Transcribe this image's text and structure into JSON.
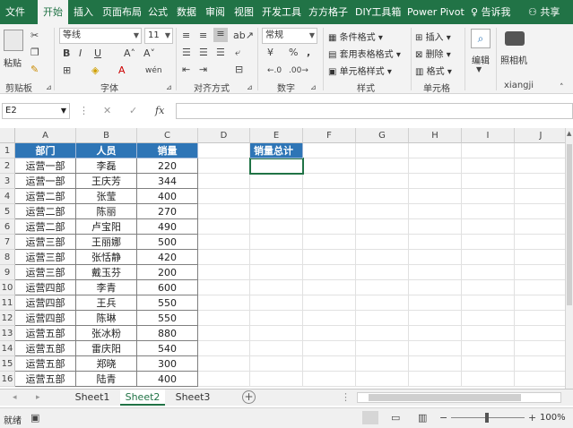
{
  "tabs": [
    "文件",
    "开始",
    "插入",
    "页面布局",
    "公式",
    "数据",
    "审阅",
    "视图",
    "开发工具",
    "方方格子",
    "DIY工具箱",
    "Power Pivot"
  ],
  "active_tab": "开始",
  "tell_me": "告诉我",
  "share": "共享",
  "clipboard": {
    "paste_label": "粘贴",
    "group": "剪贴板"
  },
  "font": {
    "name": "等线",
    "size": "11",
    "bold": "B",
    "italic": "I",
    "underline": "U",
    "font_color_glyph": "A",
    "phonetic": "wén",
    "group": "字体"
  },
  "alignment": {
    "group": "对齐方式"
  },
  "number": {
    "format": "常规",
    "currency": "¥",
    "percent": "%",
    "comma": ",",
    "group": "数字"
  },
  "styles": {
    "conditional": "条件格式",
    "table": "套用表格格式",
    "cell": "单元格样式",
    "group": "样式"
  },
  "cells": {
    "insert": "插入",
    "delete": "删除",
    "format": "格式",
    "group": "单元格"
  },
  "editing": {
    "label": "编辑"
  },
  "camera": {
    "label": "照相机",
    "group": "xiangji"
  },
  "formula_bar": {
    "name_box": "E2",
    "fx": "fx",
    "value": ""
  },
  "columns": [
    "A",
    "B",
    "C",
    "D",
    "E",
    "F",
    "G",
    "H",
    "I",
    "J"
  ],
  "rows": [
    "1",
    "2",
    "3",
    "4",
    "5",
    "6",
    "7",
    "8",
    "9",
    "10",
    "11",
    "12",
    "13",
    "14",
    "15",
    "16"
  ],
  "table": {
    "headers": [
      "部门",
      "人员",
      "销量"
    ],
    "rows": [
      [
        "运营一部",
        "李磊",
        "220"
      ],
      [
        "运营一部",
        "王庆芳",
        "344"
      ],
      [
        "运营二部",
        "张莹",
        "400"
      ],
      [
        "运营二部",
        "陈丽",
        "270"
      ],
      [
        "运营二部",
        "卢宝阳",
        "490"
      ],
      [
        "运营三部",
        "王丽娜",
        "500"
      ],
      [
        "运营三部",
        "张恬静",
        "420"
      ],
      [
        "运营三部",
        "戴玉芬",
        "200"
      ],
      [
        "运营四部",
        "李青",
        "600"
      ],
      [
        "运营四部",
        "王兵",
        "550"
      ],
      [
        "运营四部",
        "陈琳",
        "550"
      ],
      [
        "运营五部",
        "张冰粉",
        "880"
      ],
      [
        "运营五部",
        "雷庆阳",
        "540"
      ],
      [
        "运营五部",
        "郑晓",
        "300"
      ],
      [
        "运营五部",
        "陆青",
        "400"
      ]
    ]
  },
  "summary_header": "销量总计",
  "sheets": [
    "Sheet1",
    "Sheet2",
    "Sheet3"
  ],
  "active_sheet": "Sheet2",
  "status": {
    "ready": "就绪",
    "zoom": "100%"
  },
  "colors": {
    "accent": "#217346",
    "header_fill": "#2e75b6"
  }
}
